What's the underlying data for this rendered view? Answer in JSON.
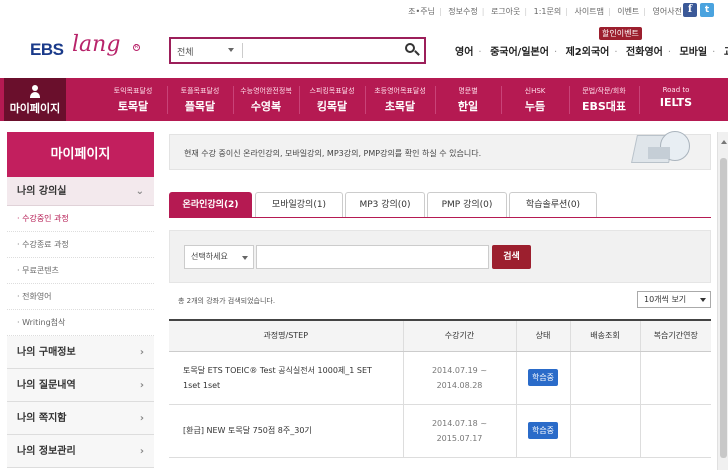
{
  "util_links": [
    "조•주님",
    "정보수정",
    "로그아웃",
    "1:1문의",
    "사이트맵",
    "이벤트",
    "영어사전"
  ],
  "logo": {
    "brand": "EBS",
    "sub": "lang",
    "reg": "R"
  },
  "search": {
    "scope": "전체",
    "value": ""
  },
  "categories": [
    "영어",
    "중국어/일본어",
    "제2외국어",
    "전화영어",
    "모바일",
    "교재"
  ],
  "promo": "할인이벤트",
  "gnb": [
    {
      "small": "",
      "big": "마이페이지"
    },
    {
      "small": "토익목표달성",
      "big": "토목달"
    },
    {
      "small": "토플목표달성",
      "big": "플목달"
    },
    {
      "small": "수능영어완전정복",
      "big": "수영복"
    },
    {
      "small": "스피킹목표달성",
      "big": "킹목달"
    },
    {
      "small": "초등영어목표달성",
      "big": "초목달"
    },
    {
      "small": "명문별",
      "big": "한일"
    },
    {
      "small": "신HSK",
      "big": "누듬"
    },
    {
      "small": "문법/작문/회화",
      "big": "EBS대표"
    },
    {
      "small": "Road to",
      "big": "IELTS"
    }
  ],
  "sidebar": {
    "title": "마이페이지",
    "open_menu": "나의 강의실",
    "sub_items": [
      "수강중인 과정",
      "수강종료 과정",
      "무료콘텐츠",
      "전화영어",
      "Writing첨삭"
    ],
    "menus": [
      "나의 구매정보",
      "나의 질문내역",
      "나의 쪽지함",
      "나의 정보관리"
    ]
  },
  "notice": "현재 수강 중이신 온라인강의, 모바일강의, MP3강의, PMP강의를 확인 하실 수 있습니다.",
  "tabs": [
    "온라인강의(2)",
    "모바일강의(1)",
    "MP3 강의(0)",
    "PMP 강의(0)",
    "학습솔루션(0)"
  ],
  "filter": {
    "select": "선택하세요",
    "button": "검색"
  },
  "count_text": "총 2개의 강좌가 검색되었습니다.",
  "per_page": "10개씩 보기",
  "table": {
    "headers": [
      "과정명/STEP",
      "수강기간",
      "상태",
      "배송조회",
      "복습기간연장"
    ],
    "rows": [
      {
        "name1": "토목달 ETS TOEIC® Test 공식실전서 1000제_1 SET",
        "name2": "1set 1set",
        "start": "2014.07.19 ~",
        "end": "2014.08.28",
        "status": "학습중"
      },
      {
        "name1": "[환급] NEW 토목달 750점 8주_30기",
        "name2": "",
        "start": "2014.07.18 ~",
        "end": "2015.07.17",
        "status": "학습중"
      }
    ]
  }
}
